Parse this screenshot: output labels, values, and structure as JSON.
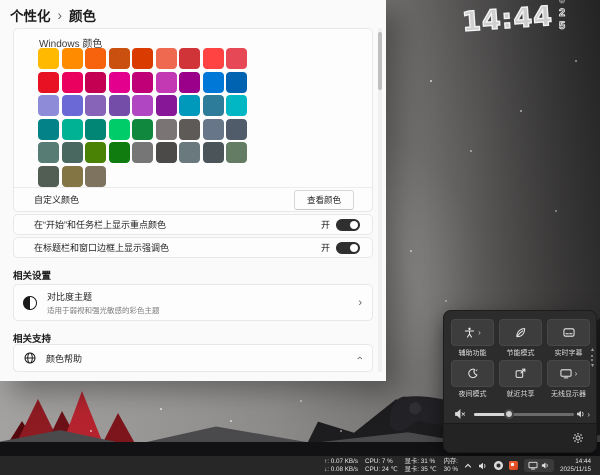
{
  "settings": {
    "breadcrumb": {
      "parent": "个性化",
      "separator": "›",
      "current": "颜色"
    },
    "palette_label": "Windows 颜色",
    "palette_colors": [
      "#ffb900",
      "#ff8c00",
      "#f7630c",
      "#ca5010",
      "#da3b01",
      "#ef6950",
      "#d13438",
      "#ff4343",
      "#e74856",
      "#e81123",
      "#ea005e",
      "#c30052",
      "#e3008c",
      "#bf0077",
      "#c239b3",
      "#9a0089",
      "#0078d7",
      "#0063b1",
      "#8e8cd8",
      "#6b69d6",
      "#8764b8",
      "#744da9",
      "#b146c2",
      "#881798",
      "#0099bc",
      "#2d7d9a",
      "#00b7c3",
      "#038387",
      "#00b294",
      "#018574",
      "#00cc6a",
      "#10893e",
      "#7a7574",
      "#5d5a58",
      "#68768a",
      "#515c6b",
      "#567c73",
      "#486860",
      "#498205",
      "#107c10",
      "#767676",
      "#4c4a48",
      "#69797e",
      "#4a5459",
      "#647c64",
      "#525e54",
      "#847545",
      "#7e735f"
    ],
    "custom_color_label": "自定义颜色",
    "view_colors_button": "查看颜色",
    "toggles": [
      {
        "label": "在“开始”和任务栏上显示重点颜色",
        "state_label": "开"
      },
      {
        "label": "在标题栏和窗口边框上显示强调色",
        "state_label": "开"
      }
    ],
    "related_settings_header": "相关设置",
    "contrast_theme": {
      "title": "对比度主题",
      "subtitle": "适用于弱视和强光敏感的彩色主题",
      "chevron": "›"
    },
    "related_support_header": "相关支持",
    "color_help_label": "颜色帮助",
    "collapse_chevron": "›",
    "accent_color": "#2f2f2f"
  },
  "desktop": {
    "clock_time": "14:44",
    "clock_seconds": [
      "0",
      "2",
      "5"
    ]
  },
  "quick_settings": {
    "tiles": [
      {
        "label": "辅助功能",
        "icon": "accessibility-icon",
        "chevron": "›"
      },
      {
        "label": "节能模式",
        "icon": "energy-saver-icon"
      },
      {
        "label": "实时字幕",
        "icon": "live-captions-icon"
      },
      {
        "label": "夜间模式",
        "icon": "night-light-icon"
      },
      {
        "label": "就近共享",
        "icon": "nearby-share-icon"
      },
      {
        "label": "无线显示器",
        "icon": "cast-icon",
        "chevron": "›"
      }
    ],
    "volume_percent": 35
  },
  "taskbar": {
    "monitor": {
      "up": "↑: 0.07 KB/s",
      "down": "↓: 0.08 KB/s",
      "cpu_usage": "CPU: 7 %",
      "cpu_temp": "CPU: 24 ℃",
      "gpu_usage": "显卡: 31 %",
      "gpu_temp": "显卡: 35 ℃",
      "mem_label": "内存:",
      "mem_value": "30 %"
    },
    "clock": {
      "time": "14:44",
      "date": "2025/11/15"
    }
  }
}
